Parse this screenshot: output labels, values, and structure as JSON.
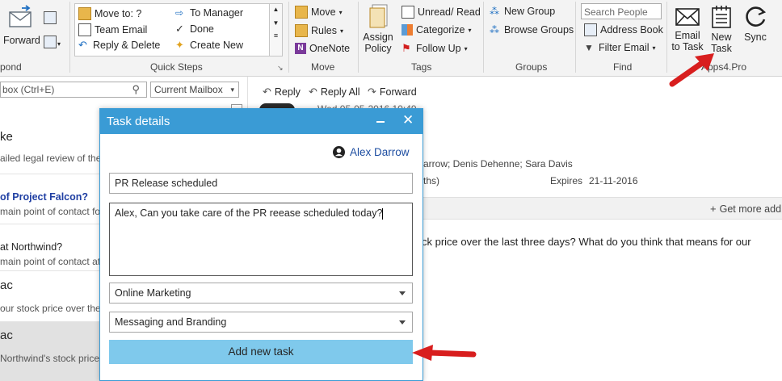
{
  "ribbon": {
    "forward_label": "Forward",
    "respond_group_label": "pond",
    "quick_steps": {
      "items": [
        "Move to: ?",
        "Team Email",
        "Reply & Delete",
        "To Manager",
        "Done",
        "Create New"
      ],
      "label": "Quick Steps"
    },
    "move": {
      "items": [
        "Move",
        "Rules",
        "OneNote"
      ],
      "label": "Move"
    },
    "tags": {
      "assign_policy": "Assign Policy",
      "items": [
        "Unread/ Read",
        "Categorize",
        "Follow Up"
      ],
      "label": "Tags"
    },
    "groups": {
      "items": [
        "New Group",
        "Browse Groups"
      ],
      "label": "Groups"
    },
    "find": {
      "search_people_placeholder": "Search People",
      "items": [
        "Address Book",
        "Filter Email"
      ],
      "label": "Find"
    },
    "apps4pro": {
      "email_to_task": "Email to Task",
      "new_task": "New Task",
      "sync": "Sync",
      "label": "Apps4.Pro"
    }
  },
  "message_list": {
    "search_placeholder": "box (Ctrl+E)",
    "scope": "Current Mailbox",
    "items": [
      {
        "sender": "ke",
        "preview": "ailed legal review of the"
      },
      {
        "sender": "of Project Falcon?",
        "preview": "main point of contact fo"
      },
      {
        "sender": "at Northwind?",
        "preview": "main point of contact at"
      },
      {
        "sender": "ac",
        "preview": "our stock price over the l"
      },
      {
        "sender": "ac",
        "preview": "Northwind's stock price c"
      }
    ]
  },
  "reading_pane": {
    "actions": [
      "Reply",
      "Reply All",
      "Forward"
    ],
    "date_partial": "Wed 05-05-2016 10:49",
    "recipients": "arrow; Denis Dehenne; Sara Davis",
    "retention": "ths)",
    "expires_label": "Expires",
    "expires_date": "21-11-2016",
    "get_more": "Get more add",
    "body_line1": "ck price over the last three days?  What do you think that means for our"
  },
  "dialog": {
    "title": "Task details",
    "user": "Alex Darrow",
    "task_title": "PR Release scheduled",
    "description": "Alex, Can you take care of the PR reease scheduled today?",
    "category": "Online Marketing",
    "subcategory": "Messaging and Branding",
    "submit_label": "Add new task"
  },
  "colors": {
    "accent": "#3a9bd5",
    "button": "#7fc9ec",
    "user_link": "#1e4ea1",
    "arrow": "#d81e1e",
    "link_blue": "#1f3fa3"
  }
}
